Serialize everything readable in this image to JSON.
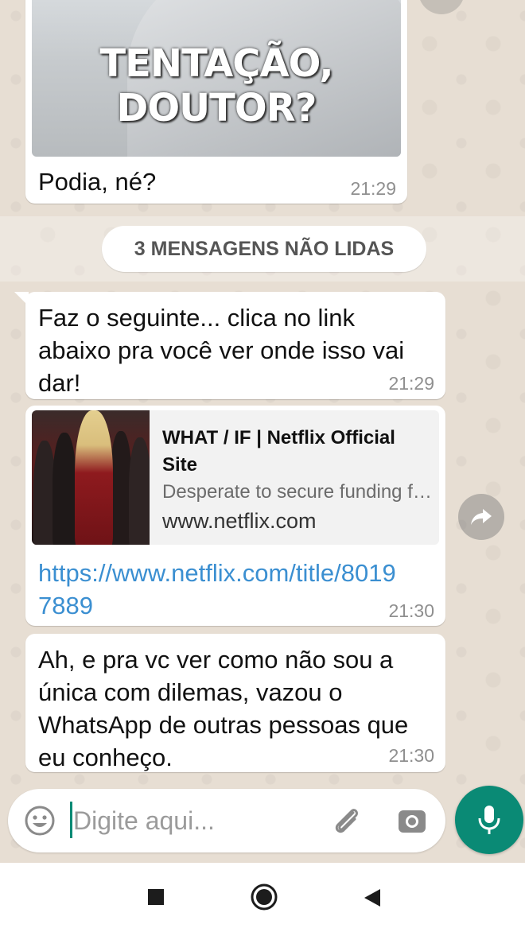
{
  "messages": [
    {
      "image_caption": "TENTAÇÃO, DOUTOR?",
      "text": "Podia, né?",
      "time": "21:29"
    },
    {
      "text": "Faz o seguinte... clica no link abaixo pra você ver onde isso vai dar!",
      "time": "21:29"
    },
    {
      "preview": {
        "title": "WHAT / IF | Netflix Official Site",
        "description": "Desperate to secure funding for her groundbreaking research",
        "domain": "www.netflix.com"
      },
      "link": "https://www.netflix.com/title/80197889",
      "time": "21:30"
    },
    {
      "text": "Ah, e pra vc ver como não sou a única com dilemas, vazou o WhatsApp de outras pessoas que eu conheço.",
      "time": "21:30"
    }
  ],
  "unread_banner": "3 MENSAGENS NÃO LIDAS",
  "input": {
    "placeholder": "Digite aqui..."
  },
  "icons": {
    "emoji": "emoji-icon",
    "attach": "paperclip-icon",
    "camera": "camera-icon",
    "mic": "mic-icon",
    "forward": "forward-icon"
  },
  "colors": {
    "accent": "#0a8a75",
    "link": "#3b8fd1"
  }
}
